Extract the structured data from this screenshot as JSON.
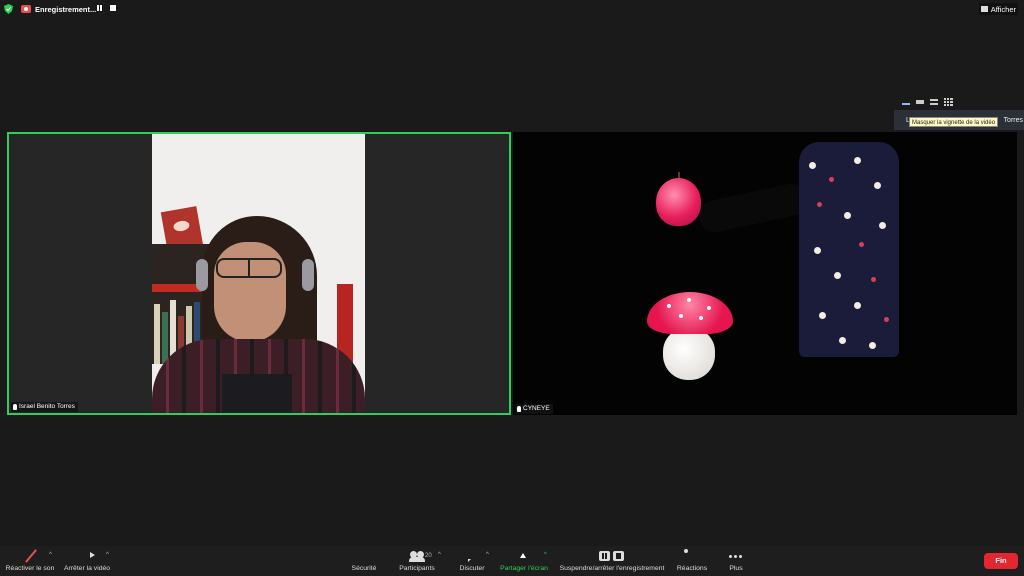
{
  "topbar": {
    "recording_label": "Enregistrement...",
    "view_label": "Afficher"
  },
  "layout": {
    "name_strip_prefix": "L",
    "name_strip_suffix": "Torres",
    "tooltip": "Masquer la vignette de la vidéo"
  },
  "participants": [
    {
      "name": "Israel Benito Torres",
      "active_speaker": true
    },
    {
      "name": "CYNEYE",
      "active_speaker": false
    }
  ],
  "toolbar": {
    "unmute_label": "Réactiver le son",
    "stop_video_label": "Arrêter la vidéo",
    "security_label": "Sécurité",
    "participants_label": "Participants",
    "participants_count": "20",
    "chat_label": "Discuter",
    "share_label": "Partager l'écran",
    "record_label": "Suspendre/arrêter l'enregistrement",
    "reactions_label": "Réactions",
    "more_label": "Plus",
    "end_label": "Fin"
  },
  "colors": {
    "active_speaker_border": "#2fce5a",
    "share_green": "#2fce5a",
    "end_red": "#e3262f",
    "recording_red": "#e8504e",
    "background": "#1a1a1a"
  }
}
